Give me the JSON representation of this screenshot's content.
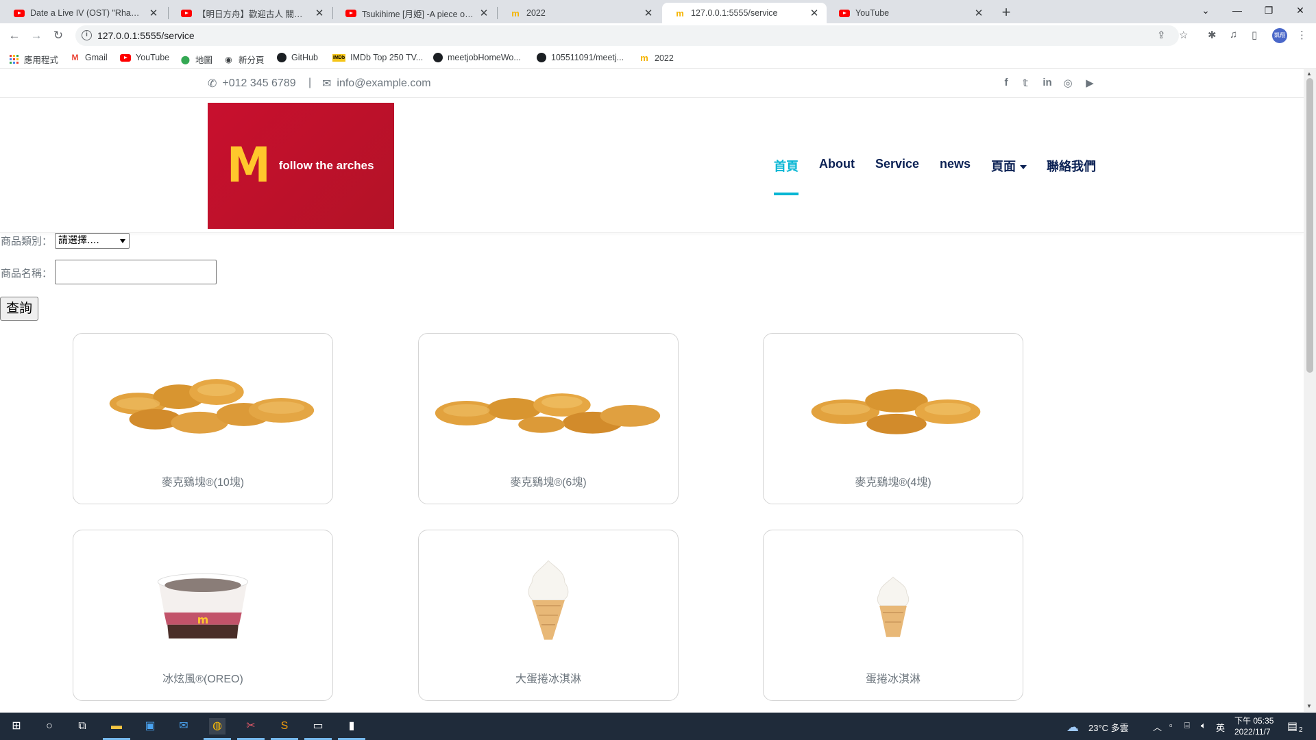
{
  "browser": {
    "tabs": [
      {
        "title": "Date a Live IV (OST) \"Rhapsody",
        "icon": "youtube-icon"
      },
      {
        "title": "【明日方舟】歡迎古人 關跑 #GK",
        "icon": "youtube-icon"
      },
      {
        "title": "Tsukihime [月姫] -A piece of blu",
        "icon": "youtube-icon"
      },
      {
        "title": "2022",
        "icon": "mcdonalds-icon"
      },
      {
        "title": "127.0.0.1:5555/service",
        "icon": "mcdonalds-icon"
      },
      {
        "title": "YouTube",
        "icon": "youtube-icon"
      }
    ],
    "url": "127.0.0.1:5555/service",
    "profile_initials": "凱翔",
    "bookmarks": [
      {
        "label": "應用程式",
        "icon": "apps-icon"
      },
      {
        "label": "Gmail",
        "icon": "gmail-icon"
      },
      {
        "label": "YouTube",
        "icon": "youtube-icon"
      },
      {
        "label": "地圖",
        "icon": "maps-icon"
      },
      {
        "label": "新分頁",
        "icon": "globe-icon"
      },
      {
        "label": "GitHub",
        "icon": "github-icon"
      },
      {
        "label": "IMDb Top 250 TV...",
        "icon": "imdb-icon"
      },
      {
        "label": "meetjobHomeWo...",
        "icon": "github-icon"
      },
      {
        "label": "105511091/meetj...",
        "icon": "github-icon"
      },
      {
        "label": "2022",
        "icon": "mcdonalds-icon"
      }
    ]
  },
  "site": {
    "phone": "+012 345 6789",
    "divider": "|",
    "email": "info@example.com",
    "social_icons": [
      "facebook-icon",
      "twitter-icon",
      "linkedin-icon",
      "instagram-icon",
      "youtube-icon"
    ],
    "logo_letter": "M",
    "logo_text": "follow the arches",
    "nav": [
      "首頁",
      "About",
      "Service",
      "news",
      "頁面",
      "聯絡我們"
    ],
    "active_nav": "首頁",
    "accent_color": "#06b6d4",
    "nav_color": "#0b2154",
    "brand_red": "#c8102e",
    "brand_yellow": "#ffc72c"
  },
  "filter": {
    "category_label": "商品類別：",
    "category_value": "請選擇....",
    "name_label": "商品名稱：",
    "name_value": "",
    "submit_label": "查詢"
  },
  "products": [
    {
      "name": "麥克鷄塊®(10塊)"
    },
    {
      "name": "麥克鷄塊®(6塊)"
    },
    {
      "name": "麥克鷄塊®(4塊)"
    },
    {
      "name": "冰炫風®(OREO)"
    },
    {
      "name": "大蛋捲冰淇淋"
    },
    {
      "name": "蛋捲冰淇淋"
    }
  ],
  "taskbar": {
    "weather": "23°C 多雲",
    "input_lang": "英",
    "time": "下午 05:35",
    "date": "2022/11/7",
    "notifications": "2"
  }
}
